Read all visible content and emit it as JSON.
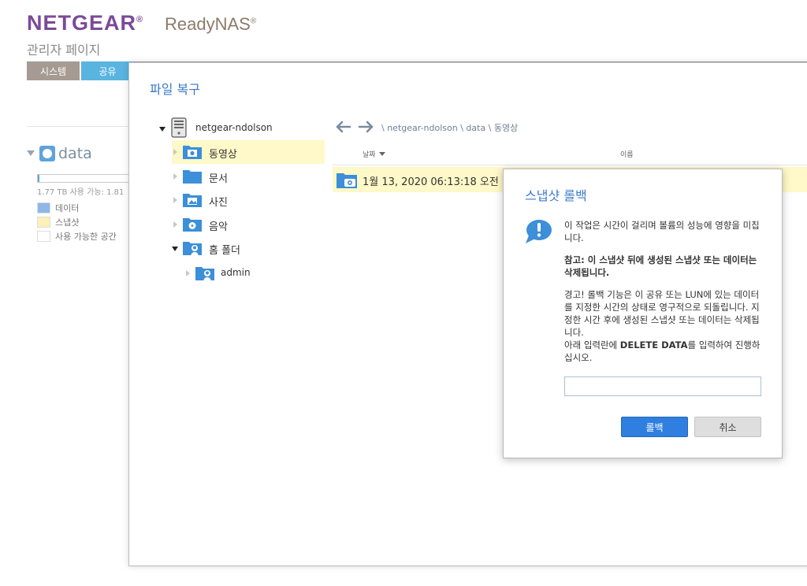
{
  "brand": {
    "logo": "NETGEAR",
    "reg1": "®",
    "product": "ReadyNAS",
    "reg2": "®"
  },
  "admin": {
    "title": "관리자 페이지"
  },
  "nav": {
    "tabs": [
      {
        "label": "시스템"
      },
      {
        "label": "공유"
      }
    ]
  },
  "volume": {
    "name": "data",
    "usage_text": "1.77 TB 사용 가능: 1.81",
    "usage_fraction": 0.02
  },
  "legend": [
    {
      "label": "데이터",
      "color": "#8db8e8"
    },
    {
      "label": "스냅샷",
      "color": "#fcf1b8"
    },
    {
      "label": "사용 가능한 공간",
      "color": "#ffffff"
    }
  ],
  "recover": {
    "title": "파일 복구",
    "tree": {
      "root": "netgear-ndolson",
      "items": [
        {
          "label": "동영상",
          "icon": "video-folder-icon"
        },
        {
          "label": "문서",
          "icon": "folder-icon"
        },
        {
          "label": "사진",
          "icon": "picture-folder-icon"
        },
        {
          "label": "음악",
          "icon": "music-folder-icon"
        },
        {
          "label": "홈 폴더",
          "icon": "user-folder-icon"
        },
        {
          "label": "admin",
          "icon": "user-folder-icon"
        }
      ]
    },
    "breadcrumb": "\\ netgear-ndolson \\ data \\ 동영상",
    "columns": {
      "date": "날짜",
      "name": "이름"
    },
    "rows": [
      {
        "date": "1월 13, 2020 06:13:18 오전"
      }
    ]
  },
  "dialog": {
    "title": "스냅샷 롤백",
    "p1": "이 작업은 시간이 걸리며 볼륨의 성능에 영향을 미칩니다.",
    "p2": "참고: 이 스냅샷 뒤에 생성된 스냅샷 또는 데이터는 삭제됩니다.",
    "p3": "경고! 롤백 기능은 이 공유 또는 LUN에 있는 데이터를 지정한 시간의 상태로 영구적으로 되돌립니다. 지정한 시간 후에 생성된 스냅샷 또는 데이터는 삭제됩니다.",
    "p4_before": "아래 입력란에 ",
    "p4_bold": "DELETE DATA",
    "p4_after": "를 입력하여 진행하십시오.",
    "input_value": "",
    "confirm_label": "롤백",
    "cancel_label": "취소"
  },
  "colors": {
    "brand_purple": "#7a4a98",
    "accent_blue": "#3d7ac8",
    "selected_row": "#fff8c8",
    "tab_active": "#5ab4e0"
  }
}
